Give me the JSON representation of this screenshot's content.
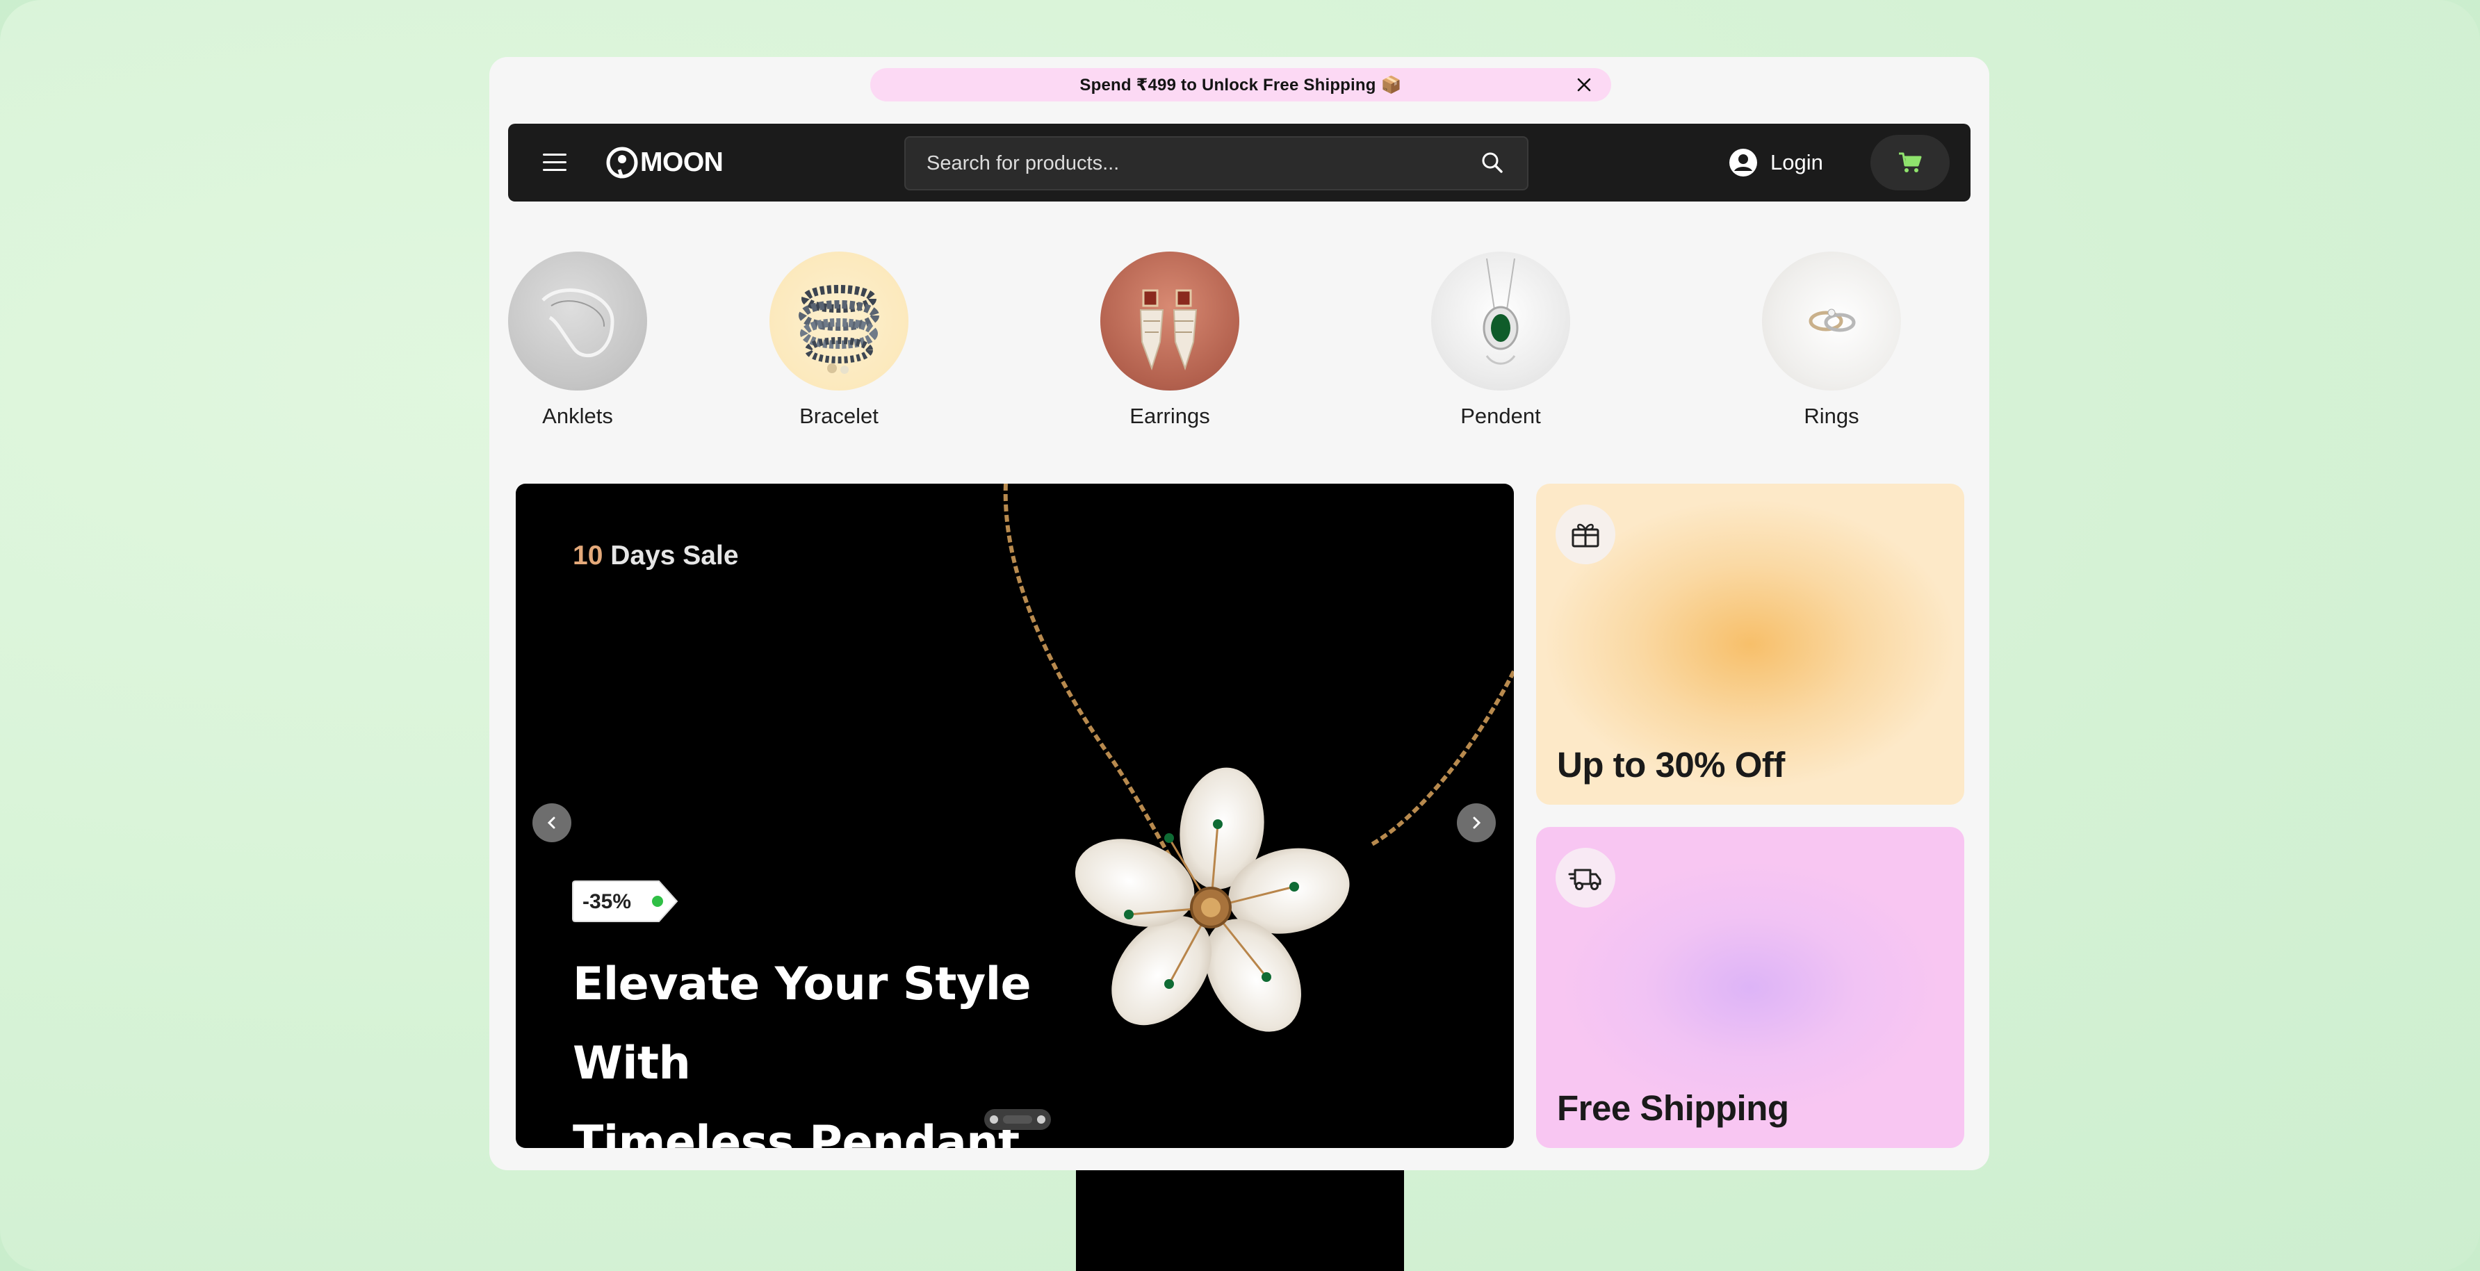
{
  "promo": {
    "text": "Spend ₹499 to Unlock Free Shipping 📦",
    "close_icon": "close-icon"
  },
  "nav": {
    "menu_icon": "hamburger-icon",
    "logo": "MOON",
    "search": {
      "placeholder": "Search for products...",
      "value": ""
    },
    "login_label": "Login",
    "cart_icon": "cart-icon",
    "accent_color": "#8fe36d"
  },
  "categories": [
    {
      "label": "Anklets"
    },
    {
      "label": "Bracelet"
    },
    {
      "label": "Earrings"
    },
    {
      "label": "Pendent"
    },
    {
      "label": "Rings"
    }
  ],
  "hero": {
    "kicker_num": "10",
    "kicker_text": " Days Sale",
    "badge": "-35%",
    "title_line1": "Elevate Your Style With",
    "title_line2": "Timeless Pendant.",
    "slide_count": 3,
    "active_slide": 2
  },
  "tiles": [
    {
      "title": "Up to 30% Off",
      "icon": "gift-icon"
    },
    {
      "title": "Free Shipping",
      "icon": "delivery-truck-icon"
    }
  ]
}
